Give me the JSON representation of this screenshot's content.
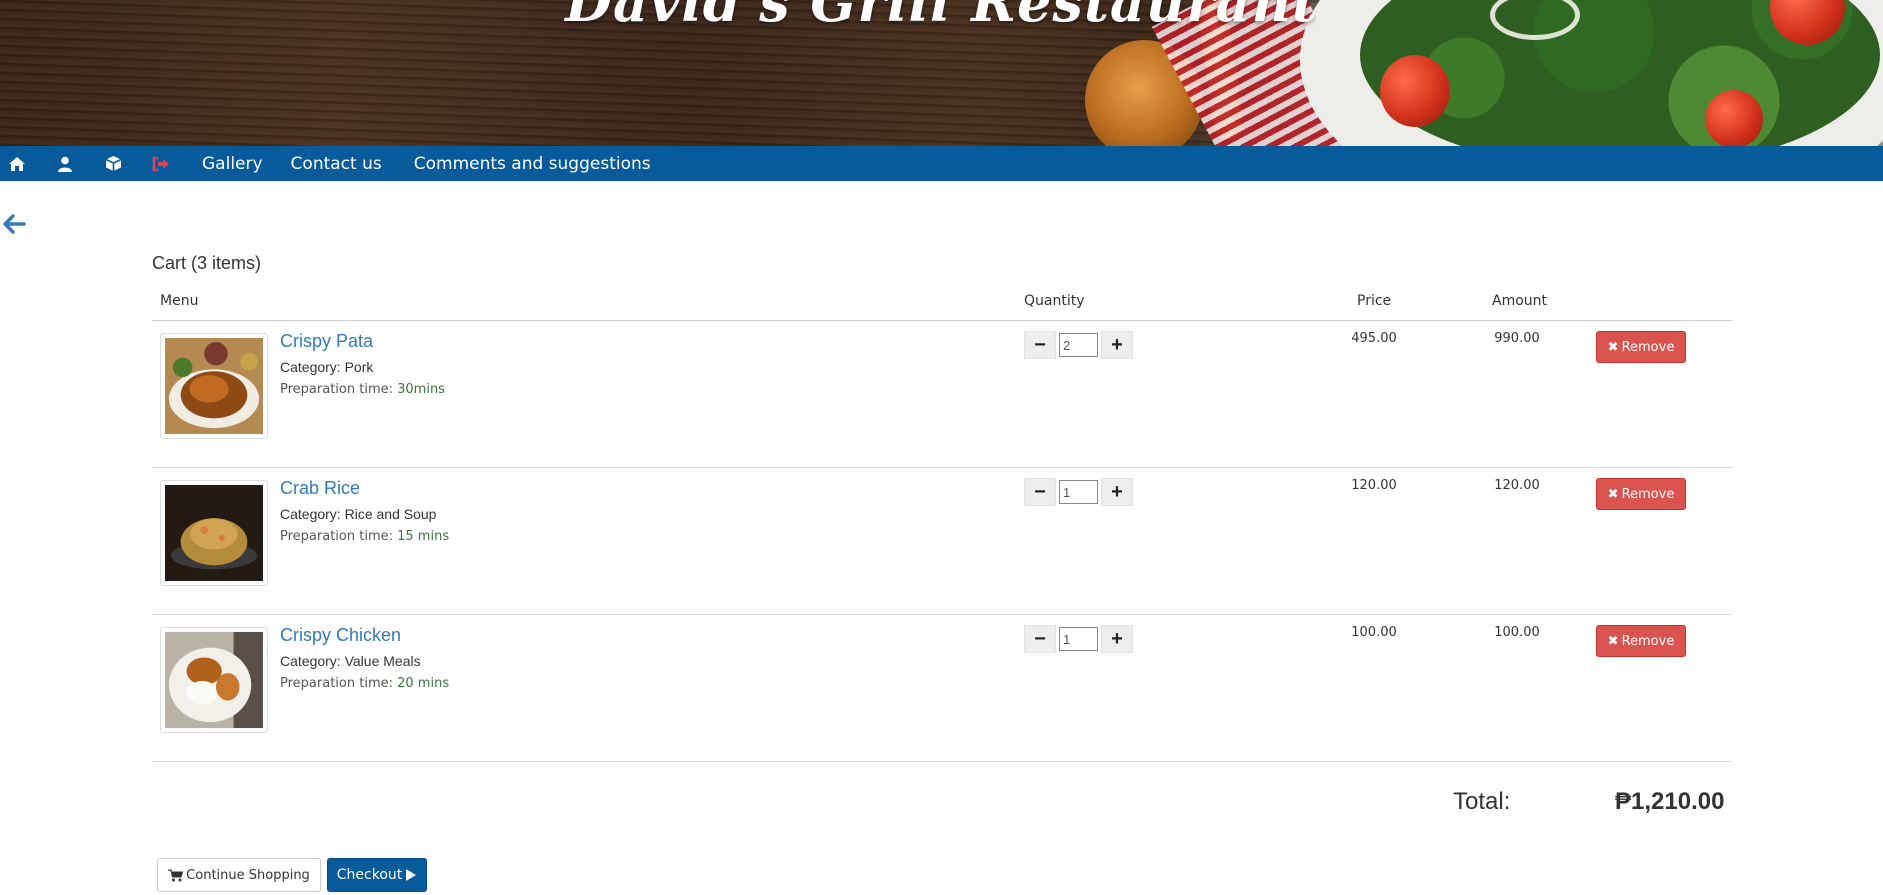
{
  "site": {
    "title": "David's Grill Restaurant"
  },
  "navbar": {
    "icons": [
      "home-icon",
      "user-icon",
      "orders-box-icon",
      "logout-icon"
    ],
    "links": [
      "Gallery",
      "Contact us",
      "Comments and suggestions"
    ]
  },
  "cart": {
    "title": "Cart (3 items)",
    "headers": {
      "menu": "Menu",
      "quantity": "Quantity",
      "price": "Price",
      "amount": "Amount"
    },
    "category_prefix": "Category:",
    "prep_prefix": "Preparation time:",
    "remove_label": "Remove",
    "items": [
      {
        "name": "Crispy Pata",
        "category": "Pork",
        "prep_time": "30mins",
        "quantity": "2",
        "price": "495.00",
        "amount": "990.00"
      },
      {
        "name": "Crab Rice",
        "category": "Rice and Soup",
        "prep_time": "15 mins",
        "quantity": "1",
        "price": "120.00",
        "amount": "120.00"
      },
      {
        "name": "Crispy Chicken",
        "category": "Value Meals",
        "prep_time": "20 mins",
        "quantity": "1",
        "price": "100.00",
        "amount": "100.00"
      }
    ],
    "total_label": "Total:",
    "total_value": "₱1,210.00"
  },
  "actions": {
    "continue_label": "Continue Shopping",
    "checkout_label": "Checkout"
  },
  "colors": {
    "brand": "#075b9a",
    "danger": "#d9534f",
    "link": "#337ab7",
    "logout": "#e0405a"
  }
}
